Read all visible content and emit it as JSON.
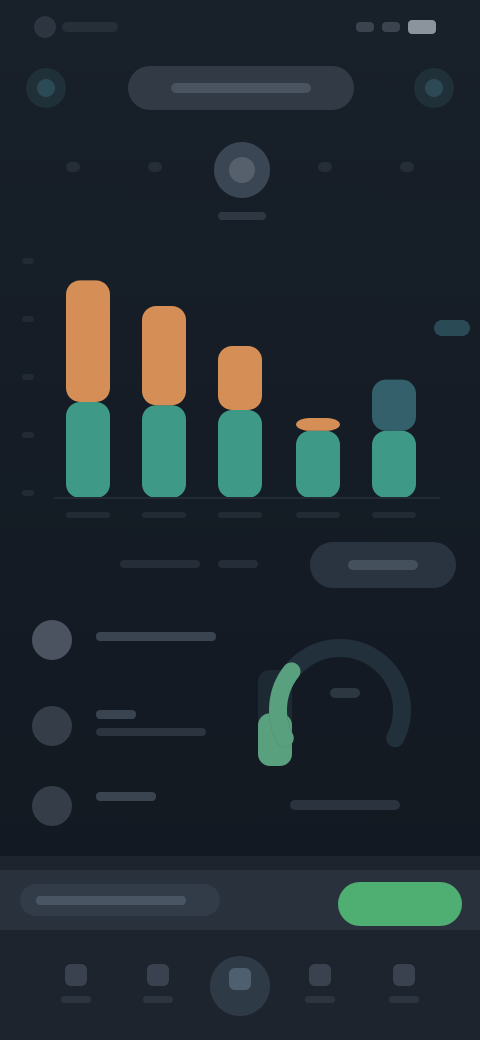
{
  "chart_data": {
    "type": "bar",
    "stacked": true,
    "categories": [
      "",
      "",
      "",
      "",
      ""
    ],
    "series": [
      {
        "values": [
          60,
          58,
          55,
          42,
          42
        ],
        "color": "#3e9a86"
      },
      {
        "values": [
          76,
          62,
          40,
          8,
          0
        ],
        "color": "#d48e56"
      },
      {
        "values": [
          0,
          0,
          0,
          0,
          32
        ],
        "color": "#33606a"
      }
    ],
    "ylim": [
      0,
      150
    ],
    "grid": false,
    "legend": "none"
  },
  "gauge": {
    "value": 0.28,
    "bar_fill": 0.55,
    "accent": "#58a07e",
    "track": "#22303b"
  },
  "colors": {
    "background": "#141a22",
    "accent_green": "#4fae72",
    "bar_orange": "#d48e56",
    "bar_teal": "#3e9a86"
  },
  "icons": {
    "top_left": "back-icon",
    "top_right": "menu-icon",
    "nav": [
      "home-icon",
      "chart-icon",
      "activity-icon",
      "calendar-icon",
      "profile-icon"
    ]
  }
}
